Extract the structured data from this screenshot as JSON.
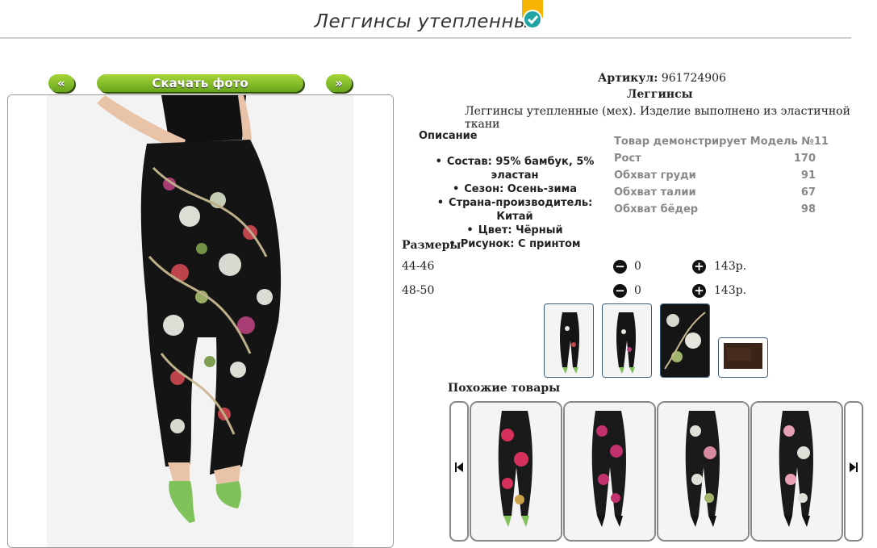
{
  "header": {
    "title": "Леггинсы утепленные"
  },
  "photo_nav": {
    "prev_label": "«",
    "download_label": "Скачать фото",
    "next_label": "»"
  },
  "product": {
    "article_label": "Артикул:",
    "article_value": "961724906",
    "category": "Леггинсы",
    "summary": "Леггинсы утепленные (мех). Изделие выполнено из эластичной ткани"
  },
  "description": {
    "heading": "Описание",
    "items": [
      "Состав: 95% бамбук, 5% эластан",
      "Сезон: Осень-зима",
      "Страна-производитель: Китай",
      "Цвет: Чёрный",
      "Рисунок: С принтом"
    ]
  },
  "model": {
    "heading": "Товар демонстрирует Модель №11",
    "rows": [
      {
        "label": "Рост",
        "value": "170"
      },
      {
        "label": "Обхват груди",
        "value": "91"
      },
      {
        "label": "Обхват талии",
        "value": "67"
      },
      {
        "label": "Обхват бёдер",
        "value": "98"
      }
    ]
  },
  "sizes": {
    "heading": "Размеры",
    "rows": [
      {
        "size": "44-46",
        "qty": "0",
        "price": "143р."
      },
      {
        "size": "48-50",
        "qty": "0",
        "price": "143р."
      }
    ]
  },
  "similar": {
    "heading": "Похожие товары"
  },
  "colors": {
    "accent_green": "#7fbf26",
    "badge_orange": "#f4b400",
    "badge_teal": "#1fa3a3",
    "thumb_border": "#3a5a78"
  }
}
